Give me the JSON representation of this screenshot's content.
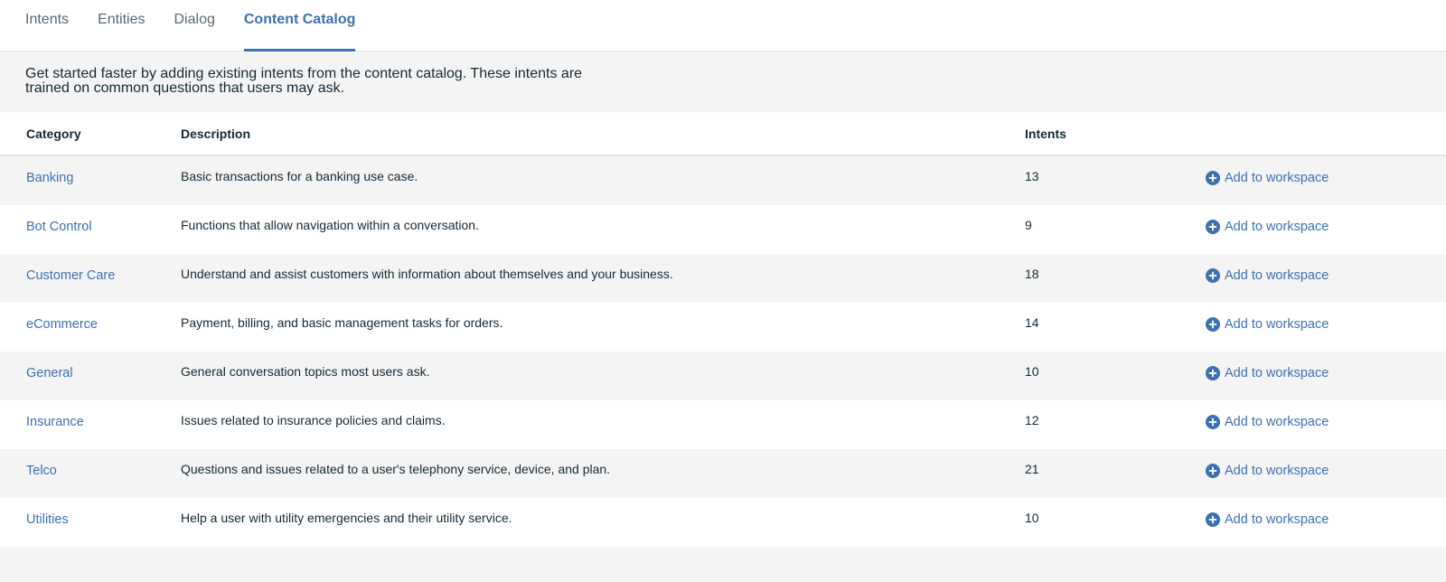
{
  "tabs": [
    {
      "label": "Intents",
      "active": false
    },
    {
      "label": "Entities",
      "active": false
    },
    {
      "label": "Dialog",
      "active": false
    },
    {
      "label": "Content Catalog",
      "active": true
    }
  ],
  "intro": "Get started faster by adding existing intents from the content catalog. These intents are trained on common questions that users may ask.",
  "table": {
    "headers": {
      "category": "Category",
      "description": "Description",
      "intents": "Intents"
    },
    "action_label": "Add to workspace",
    "action_icon": "plus-circle-icon",
    "rows": [
      {
        "category": "Banking",
        "description": "Basic transactions for a banking use case.",
        "intents": "13"
      },
      {
        "category": "Bot Control",
        "description": "Functions that allow navigation within a conversation.",
        "intents": "9"
      },
      {
        "category": "Customer Care",
        "description": "Understand and assist customers with information about themselves and your business.",
        "intents": "18"
      },
      {
        "category": "eCommerce",
        "description": "Payment, billing, and basic management tasks for orders.",
        "intents": "14"
      },
      {
        "category": "General",
        "description": "General conversation topics most users ask.",
        "intents": "10"
      },
      {
        "category": "Insurance",
        "description": "Issues related to insurance policies and claims.",
        "intents": "12"
      },
      {
        "category": "Telco",
        "description": "Questions and issues related to a user's telephony service, device, and plan.",
        "intents": "21"
      },
      {
        "category": "Utilities",
        "description": "Help a user with utility emergencies and their utility service.",
        "intents": "10"
      }
    ]
  },
  "colors": {
    "accent": "#3d70b2",
    "text": "#152935",
    "muted": "#5a6872",
    "background": "#f4f4f4"
  }
}
